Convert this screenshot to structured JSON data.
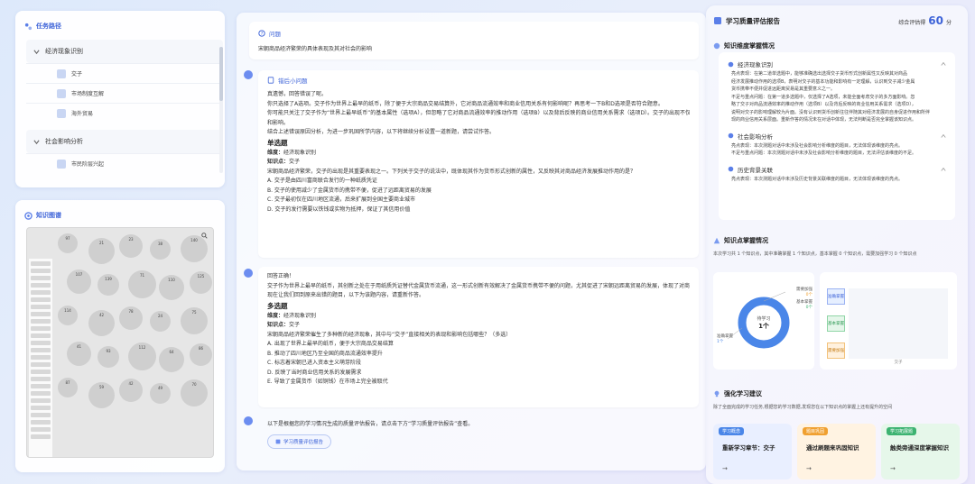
{
  "nav": {
    "title": "任务路径",
    "sections": [
      {
        "label": "经济现象识别",
        "items": [
          "交子",
          "市场制度互解",
          "海外贸易"
        ]
      },
      {
        "label": "社会影响分析",
        "items": [
          "市民阶层兴起"
        ]
      }
    ]
  },
  "graph": {
    "title": "知识图谱",
    "nodes": [
      "97",
      "21",
      "23",
      "38",
      "140",
      "107",
      "139",
      "71",
      "110",
      "125",
      "114",
      "42",
      "78",
      "24",
      "75",
      "41",
      "93",
      "112",
      "64",
      "86",
      "87",
      "59",
      "42",
      "49",
      "70"
    ]
  },
  "question": {
    "header": "问题",
    "text": "宋朝商品经济繁荣的具体表现及其对社会的影响"
  },
  "msg1": {
    "header": "错后小问题",
    "lines": [
      "真遗憾，回答错误了呢。",
      "你只选择了A选项。交子作为世界上最早的纸币，除了便于大宗商品交易结算外，它对商品流通效率和商业信用关系有何影响呢？再思考一下B和D选项是否符合题意。",
      "你可能只关注了交子作为“世界上最早纸币”的基本属性（选项A），但忽略了它对商品流通效率的推动作用（选项B）以及背后反映的商业信用关系需求（选项D）。交子的出现不仅是货币形态变革，",
      "和影响。",
      "结合上述错误原因分析，为进一步巩固所学内容，以下将继续分析设置一道新题，请尝试作答。"
    ],
    "qtype": "单选题",
    "dim_label": "维度：",
    "dim": "经济现象识别",
    "kp_label": "知识点：",
    "kp": "交子",
    "stem": "宋朝商品经济繁荣，交子的出现是其重要表现之一。下列关于交子的说法中，既体现其作为货币形式创新的属性，又反映其对商品经济发展推动作用的是？",
    "options": [
      "A. 交子是由四川富商联合发行的一种纸质凭证",
      "B. 交子的使用减少了金属货币的携带不便，促进了远距离贸易的发展",
      "C. 交子最初仅在四川地区流通，后来扩展到全国主要商业城市",
      "D. 交子的发行需要以铁钱或实物为抵押，保证了其信用价值"
    ]
  },
  "msg2": {
    "lines": [
      "回答正确！",
      "交子作为世界上最早的纸币，其创新之处在于用纸质凭证替代金属货币流通，这一形式创新有效解决了金属货币携带不便的问题，尤其促进了宋朝远距离贸易的发展，体现了对商品经济的",
      "现在让我们回到原来出错的题目，以下为该题内容，请重新作答。"
    ],
    "qtype": "多选题",
    "dim_label": "维度：",
    "dim": "经济现象识别",
    "kp_label": "知识点：",
    "kp": "交子",
    "stem": "宋朝商品经济繁荣催生了多种新的经济现象，其中与“交子”直接相关的表现和影响包括哪些？（多选）",
    "options": [
      "A. 出现了世界上最早的纸币，便于大宗商品交易结算",
      "B. 推动了四川地区乃至全国的商品流通效率提升",
      "C. 标志着宋朝已进入资本主义萌芽阶段",
      "D. 反映了当时商业信用关系的发展需求",
      "E. 导致了金属货币（如铜钱）在市场上完全被取代"
    ]
  },
  "msg3": {
    "text": "以下是根据您的学习情况生成的质量评估报告，请点击下方“学习质量评估报告”查看。",
    "button": "学习质量评估报告"
  },
  "report": {
    "title": "学习质量评估报告",
    "score_label": "综合评估得",
    "score": "60",
    "score_unit": "分",
    "knowledge_title": "知识维度掌握情况",
    "dims": [
      {
        "name": "经济现象识别",
        "lines": [
          "亮点表现：在第二道单选题中，能够准确选出选择交子货币形式创新属性又反映其对商品",
          "经济发展推动作用的选项B，表明对交子的基本功能和影响有一定理解，认识到交子减少金属",
          "货币携带不便并促进远距离贸易是其重要意义之一。",
          "不足与重点问题：在第一道多选题中，仅选择了A选项，未能全面考虑交子的多方面影响。忽",
          "略了交子对商品流通效率的推动作用（选项B）以及背后反映的商业信用关系需求（选项D），",
          "说明对交子的影响理解较为片面。没有认识到货币创新往往伴随其对经济发展的自身促进作用和所伴",
          "现的商业信用关系层面。重新作答的情况未在对话中体现，无法判断是否完全掌握该知识点。"
        ]
      },
      {
        "name": "社会影响分析",
        "lines": [
          "亮点表现：本次测题对话中未涉及社会影响分析维度的题目，无法体现该维度的亮点。",
          "不足与重点问题：本次测题对话中未涉及社会影响分析维度的题目，无法评估该维度的不足。"
        ]
      },
      {
        "name": "历史背景关联",
        "lines": [
          "亮点表现：本次测题对话中未涉及历史背景关联维度的题目，无法体现该维度的亮点。"
        ]
      }
    ],
    "kp_title": "知识点掌握情况",
    "kp_summary": "本次学习共 1 个知识点，其中准确掌握 1 个知识点，基本掌握 0 个知识点，需要加强学习 0 个知识点",
    "donut_center_label": "待学习",
    "donut_center_value": "1个",
    "legend": [
      "需要加强",
      "基本掌握",
      "准确掌握"
    ],
    "legend_values": [
      "0个",
      "0个",
      "1个"
    ],
    "bars": [
      "准确掌握",
      "基本掌握",
      "需要加强"
    ],
    "bar_axis": "交子",
    "colors": {
      "accurate": "#4a86e8",
      "basic": "#3cb371",
      "weak": "#f0a030"
    },
    "suggest_title": "强化学习建议",
    "suggest_desc": "除了全面完成的学习任务,根据您的学习数据,发现您在以下知识点的掌握上还有提升的空间",
    "cards": [
      {
        "tag": "学习概念",
        "title": "重新学习章节：交子",
        "bg": "#e9efff",
        "tagc": "#4a86e8"
      },
      {
        "tag": "题目巩固",
        "title": "通过刷题来巩固知识",
        "bg": "#fff3e2",
        "tagc": "#f0a030"
      },
      {
        "tag": "学习拓展题",
        "title": "触类旁通深度掌握知识",
        "bg": "#e6f7ea",
        "tagc": "#3cb371"
      }
    ]
  }
}
